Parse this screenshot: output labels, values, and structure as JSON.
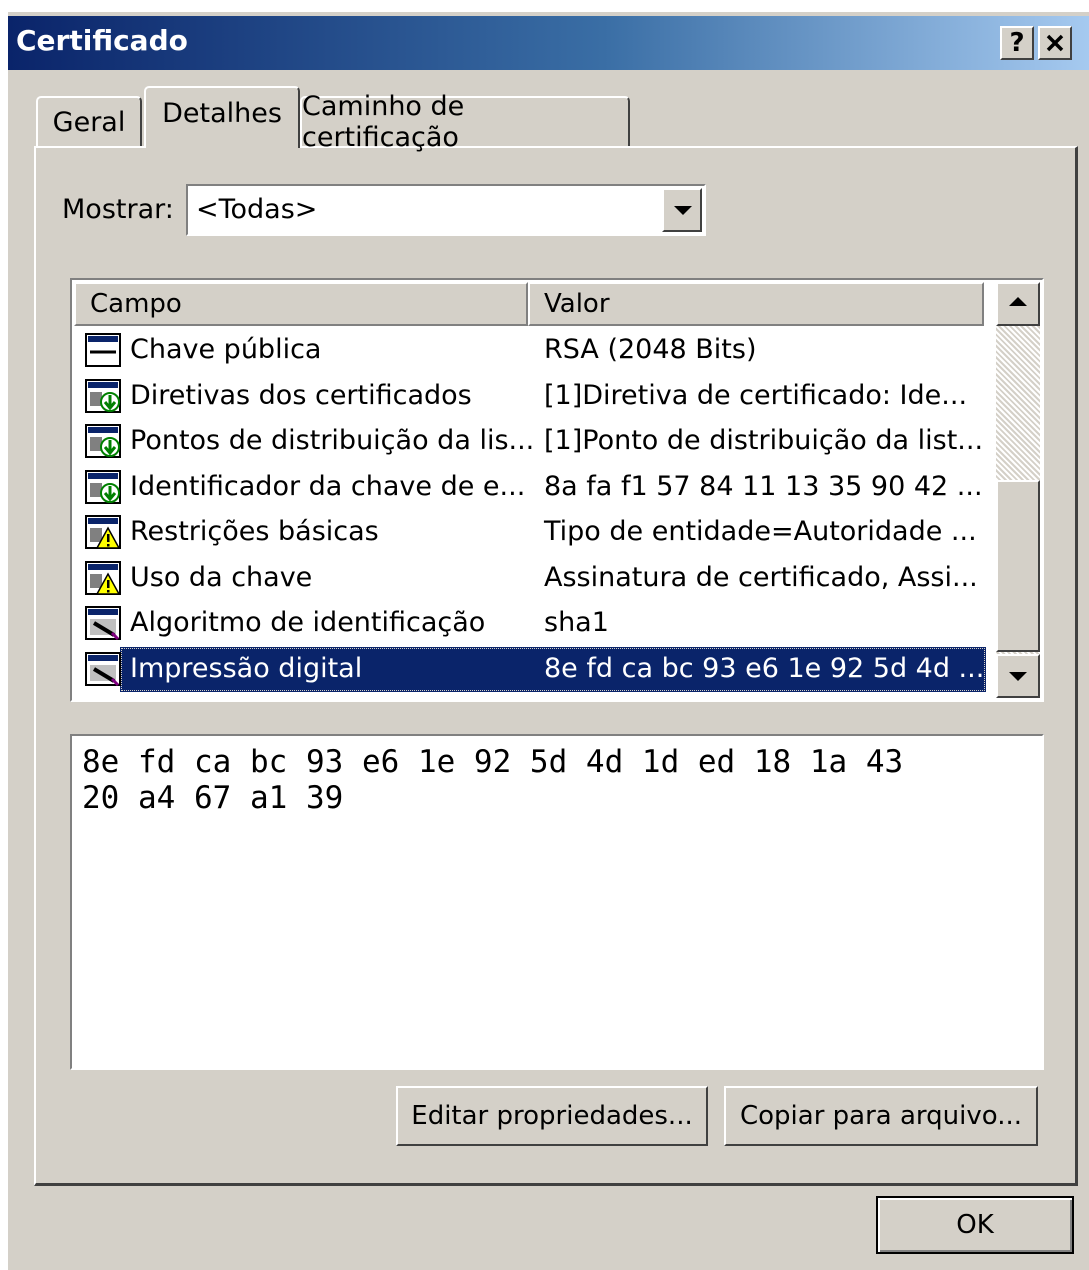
{
  "window": {
    "title": "Certificado",
    "help_label": "?",
    "close_label": "✕"
  },
  "tabs": [
    {
      "label": "Geral"
    },
    {
      "label": "Detalhes",
      "selected": true
    },
    {
      "label": "Caminho de certificação"
    }
  ],
  "show_filter": {
    "label": "Mostrar:",
    "value": "<Todas>"
  },
  "fields_list": {
    "columns": [
      "Campo",
      "Valor"
    ],
    "rows": [
      {
        "icon": "field-plain-icon",
        "field": "Chave pública",
        "value": "RSA (2048 Bits)"
      },
      {
        "icon": "extension-icon",
        "field": "Diretivas dos certificados",
        "value": "[1]Diretiva de certificado: Ide..."
      },
      {
        "icon": "extension-icon",
        "field": "Pontos de distribuição da lis...",
        "value": "[1]Ponto de distribuição da list..."
      },
      {
        "icon": "extension-icon",
        "field": "Identificador da chave de e...",
        "value": "8a fa f1 57 84 11 13 35 90 42 ..."
      },
      {
        "icon": "critical-extension-icon",
        "field": "Restrições básicas",
        "value": "Tipo de entidade=Autoridade ..."
      },
      {
        "icon": "critical-extension-icon",
        "field": "Uso da chave",
        "value": "Assinatura de certificado, Assi..."
      },
      {
        "icon": "property-icon",
        "field": "Algoritmo de identificação",
        "value": "sha1"
      },
      {
        "icon": "property-icon",
        "field": "Impressão digital",
        "value": "8e fd ca bc 93 e6 1e 92 5d 4d ...",
        "selected": true
      }
    ]
  },
  "detail_value": "8e fd ca bc 93 e6 1e 92 5d 4d 1d ed 18 1a 43\n20 a4 67 a1 39",
  "buttons": {
    "edit_properties": "Editar propriedades...",
    "copy_to_file": "Copiar para arquivo...",
    "ok": "OK"
  },
  "colors": {
    "title_bar": "#0a246a",
    "selection": "#0a246a",
    "face": "#d4d0c8"
  }
}
